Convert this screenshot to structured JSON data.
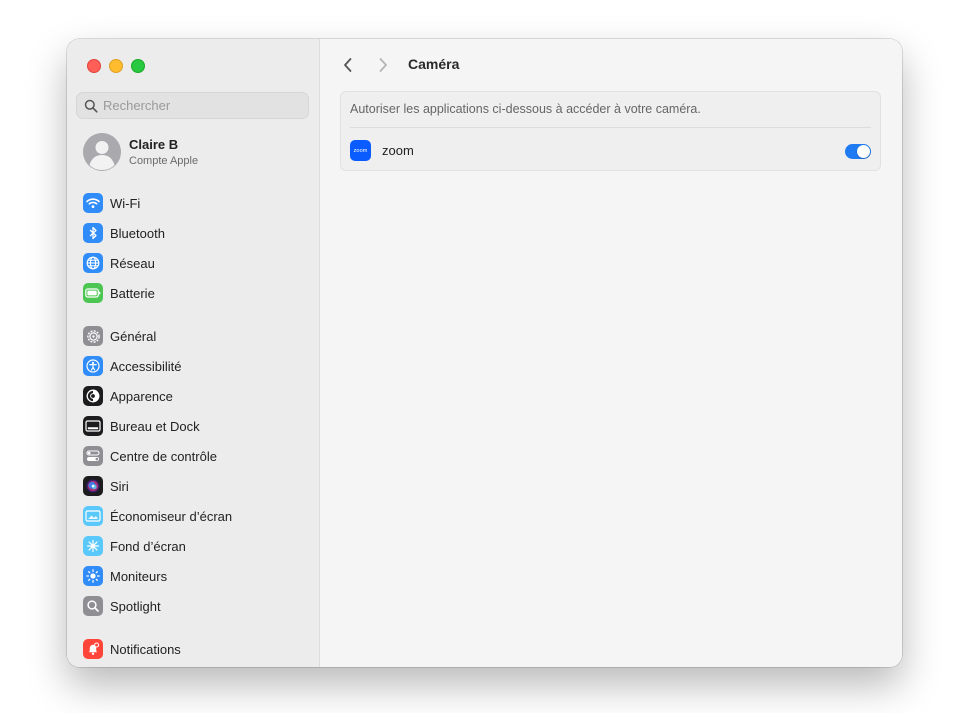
{
  "window": {
    "traffic_lights": [
      "close",
      "minimize",
      "zoom"
    ]
  },
  "sidebar": {
    "search": {
      "placeholder": "Rechercher",
      "value": ""
    },
    "account": {
      "name": "Claire B",
      "subtitle": "Compte Apple"
    },
    "items": [
      {
        "label": "Wi-Fi",
        "icon": "wifi-icon",
        "color": "#2f8cf8"
      },
      {
        "label": "Bluetooth",
        "icon": "bluetooth-icon",
        "color": "#2f8cf8"
      },
      {
        "label": "Réseau",
        "icon": "globe-icon",
        "color": "#2f8cf8"
      },
      {
        "label": "Batterie",
        "icon": "battery-icon",
        "color": "#4cc552"
      },
      {
        "label": "Général",
        "icon": "gear-icon",
        "color": "#8e8e93"
      },
      {
        "label": "Accessibilité",
        "icon": "accessibility-icon",
        "color": "#2f8cf8"
      },
      {
        "label": "Apparence",
        "icon": "appearance-icon",
        "color": "#1c1c1e"
      },
      {
        "label": "Bureau et Dock",
        "icon": "dock-icon",
        "color": "#1c1c1e"
      },
      {
        "label": "Centre de contrôle",
        "icon": "control-center-icon",
        "color": "#8e8e93"
      },
      {
        "label": "Siri",
        "icon": "siri-icon",
        "color": "#1c1c1e"
      },
      {
        "label": "Économiseur d’écran",
        "icon": "screensaver-icon",
        "color": "#5ac8fa"
      },
      {
        "label": "Fond d’écran",
        "icon": "wallpaper-icon",
        "color": "#5ac8fa"
      },
      {
        "label": "Moniteurs",
        "icon": "display-icon",
        "color": "#2f8cf8"
      },
      {
        "label": "Spotlight",
        "icon": "spotlight-icon",
        "color": "#8e8e93"
      },
      {
        "label": "Notifications",
        "icon": "notifications-icon",
        "color": "#ff453a"
      }
    ]
  },
  "main": {
    "title": "Caméra",
    "description": "Autoriser les applications ci-dessous à accéder à votre caméra.",
    "apps": [
      {
        "name": "zoom",
        "icon_text": "zoom",
        "enabled": true
      }
    ]
  },
  "colors": {
    "accent": "#1f7bf2",
    "zoom_brand": "#0b5cff"
  }
}
